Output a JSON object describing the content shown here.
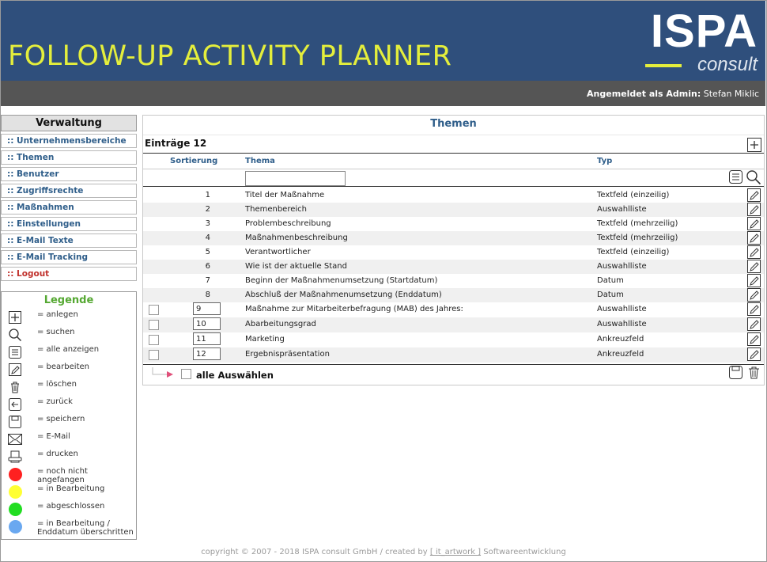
{
  "header": {
    "app_title": "FOLLOW-UP ACTIVITY PLANNER",
    "logo_main": "ISPA",
    "logo_sub": "consult",
    "login_label": "Angemeldet als Admin:",
    "login_user": "Stefan Miklic",
    "bg_color": "#2f4f7c",
    "title_color": "#e4ee3c"
  },
  "sidebar": {
    "heading": "Verwaltung",
    "items": [
      {
        "label": ":: Unternehmensbereiche"
      },
      {
        "label": ":: Themen"
      },
      {
        "label": ":: Benutzer"
      },
      {
        "label": ":: Zugriffsrechte"
      },
      {
        "label": ":: Maßnahmen"
      },
      {
        "label": ":: Einstellungen"
      },
      {
        "label": ":: E-Mail Texte"
      },
      {
        "label": ":: E-Mail Tracking"
      },
      {
        "label": ":: Logout"
      }
    ]
  },
  "legend": {
    "title": "Legende",
    "items": [
      {
        "icon": "plus-icon",
        "label": "= anlegen"
      },
      {
        "icon": "search-icon",
        "label": "= suchen"
      },
      {
        "icon": "list-icon",
        "label": "= alle anzeigen"
      },
      {
        "icon": "pencil-icon",
        "label": "= bearbeiten"
      },
      {
        "icon": "trash-icon",
        "label": "= löschen"
      },
      {
        "icon": "back-icon",
        "label": "= zurück"
      },
      {
        "icon": "save-icon",
        "label": "= speichern"
      },
      {
        "icon": "mail-icon",
        "label": "= E-Mail"
      },
      {
        "icon": "print-icon",
        "label": "= drucken"
      },
      {
        "icon": "red-dot",
        "label": "= noch nicht angefangen",
        "color": "#ff2020"
      },
      {
        "icon": "yellow-dot",
        "label": "= in Bearbeitung",
        "color": "#ffff33"
      },
      {
        "icon": "green-dot",
        "label": "= abgeschlossen",
        "color": "#22dd22"
      },
      {
        "icon": "blue-dot",
        "label": "= in Bearbeitung /",
        "label2": "Enddatum überschritten",
        "color": "#6aa8f0"
      }
    ]
  },
  "main": {
    "title": "Themen",
    "entries_label": "Einträge 12",
    "columns": {
      "sort": "Sortierung",
      "thema": "Thema",
      "typ": "Typ"
    },
    "filter_value": "",
    "rows": [
      {
        "sort": "1",
        "thema": "Titel der Maßnahme",
        "typ": "Textfeld (einzeilig)"
      },
      {
        "sort": "2",
        "thema": "Themenbereich",
        "typ": "Auswahlliste"
      },
      {
        "sort": "3",
        "thema": "Problembeschreibung",
        "typ": "Textfeld (mehrzeilig)"
      },
      {
        "sort": "4",
        "thema": "Maßnahmenbeschreibung",
        "typ": "Textfeld (mehrzeilig)"
      },
      {
        "sort": "5",
        "thema": "Verantwortlicher",
        "typ": "Textfeld (einzeilig)"
      },
      {
        "sort": "6",
        "thema": "Wie ist der aktuelle Stand",
        "typ": "Auswahlliste"
      },
      {
        "sort": "7",
        "thema": "Beginn der Maßnahmenumsetzung (Startdatum)",
        "typ": "Datum"
      },
      {
        "sort": "8",
        "thema": "Abschluß der Maßnahmenumsetzung (Enddatum)",
        "typ": "Datum"
      },
      {
        "sort": "9",
        "thema": "Maßnahme zur Mitarbeiterbefragung (MAB) des Jahres:",
        "typ": "Auswahlliste"
      },
      {
        "sort": "10",
        "thema": "Abarbeitungsgrad",
        "typ": "Auswahlliste"
      },
      {
        "sort": "11",
        "thema": "Marketing",
        "typ": "Ankreuzfeld"
      },
      {
        "sort": "12",
        "thema": "Ergebnispräsentation",
        "typ": "Ankreuzfeld"
      }
    ],
    "select_all_label": "alle Auswählen"
  },
  "footer": {
    "copyright_prefix": "copyright © 2007 - 2018 ISPA consult GmbH / created by",
    "link_text": "[ it_artwork ]",
    "copyright_suffix": "Softwareentwicklung"
  }
}
